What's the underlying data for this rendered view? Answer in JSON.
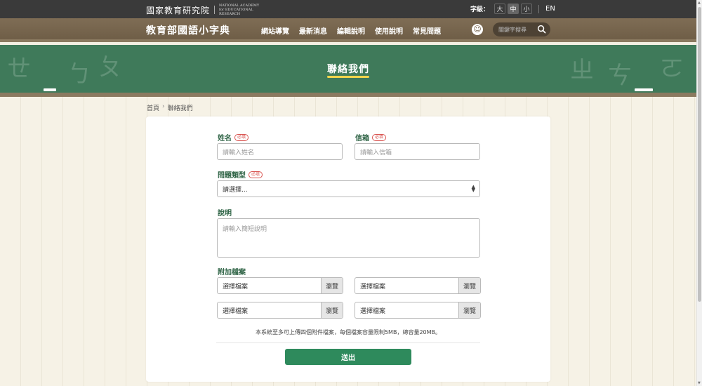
{
  "topbar": {
    "logo_zh": "國家教育研究院",
    "logo_en": "NATIONAL ACADEMY for EDUCATIONAL RESEARCH",
    "fontsize_label": "字級：",
    "fontsize_options": [
      "大",
      "中",
      "小"
    ],
    "fontsize_selected": "中",
    "lang": "EN"
  },
  "navbar": {
    "site_title": "教育部國語小字典",
    "items": [
      "網站導覽",
      "最新消息",
      "編輯說明",
      "使用說明",
      "常見問題"
    ],
    "search_placeholder": "關鍵字搜尋"
  },
  "board": {
    "title": "聯絡我們"
  },
  "breadcrumb": {
    "home": "首頁",
    "sep": "›",
    "current": "聯絡我們"
  },
  "form": {
    "required_badge": "必填",
    "name": {
      "label": "姓名",
      "placeholder": "請輸入姓名"
    },
    "email": {
      "label": "信箱",
      "placeholder": "請輸入信箱"
    },
    "type": {
      "label": "問題類型",
      "value": "請選擇..."
    },
    "desc": {
      "label": "說明",
      "placeholder": "請輸入簡短說明"
    },
    "attach": {
      "label": "附加檔案",
      "file_text": "選擇檔案",
      "browse": "瀏覽"
    },
    "note": "本系統至多可上傳四個附件檔案，每個檔案容量限制5MB，總容量20MB。",
    "submit": "送出"
  },
  "colors": {
    "accent": "#2e8a5c",
    "label": "#2f6446",
    "board": "#3f7a5a",
    "wood": "#6f5e47"
  }
}
